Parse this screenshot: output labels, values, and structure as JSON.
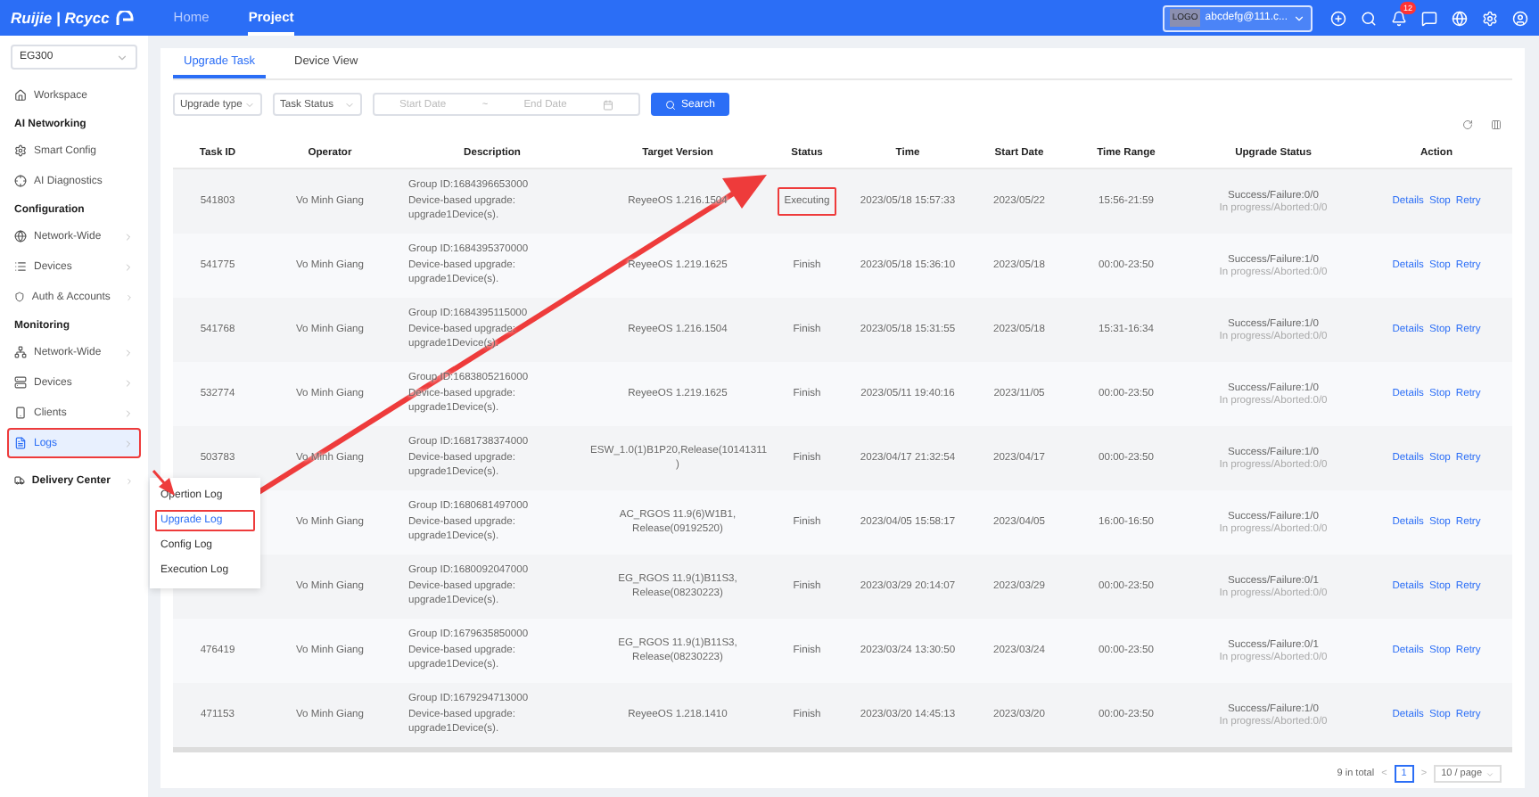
{
  "topbar": {
    "brand": "Ruijie | Rcycc",
    "nav": [
      {
        "label": "Home",
        "selected": false
      },
      {
        "label": "Project",
        "selected": true
      }
    ],
    "account": {
      "logo": "LOGO",
      "label": "abcdefg@111.c..."
    },
    "notifications": "12"
  },
  "sidebar": {
    "project": "EG300",
    "items": [
      {
        "kind": "item",
        "label": "Workspace",
        "expandable": false,
        "selected": false,
        "annotated": false
      },
      {
        "kind": "section",
        "label": "AI Networking"
      },
      {
        "kind": "item",
        "label": "Smart Config",
        "expandable": false,
        "selected": false,
        "annotated": false
      },
      {
        "kind": "item",
        "label": "AI Diagnostics",
        "expandable": false,
        "selected": false,
        "annotated": false
      },
      {
        "kind": "section",
        "label": "Configuration"
      },
      {
        "kind": "item",
        "label": "Network-Wide",
        "expandable": true,
        "selected": false,
        "annotated": false
      },
      {
        "kind": "item",
        "label": "Devices",
        "expandable": true,
        "selected": false,
        "annotated": false
      },
      {
        "kind": "item",
        "label": "Auth & Accounts",
        "expandable": true,
        "selected": false,
        "annotated": false
      },
      {
        "kind": "section",
        "label": "Monitoring"
      },
      {
        "kind": "item",
        "label": "Network-Wide",
        "expandable": true,
        "selected": false,
        "annotated": false
      },
      {
        "kind": "item",
        "label": "Devices",
        "expandable": true,
        "selected": false,
        "annotated": false
      },
      {
        "kind": "item",
        "label": "Clients",
        "expandable": true,
        "selected": false,
        "annotated": false
      },
      {
        "kind": "item",
        "label": "Logs",
        "expandable": true,
        "selected": true,
        "annotated": true
      },
      {
        "kind": "heading",
        "label": "Delivery Center",
        "expandable": true,
        "selected": false,
        "annotated": false
      }
    ]
  },
  "submenu": [
    {
      "label": "Opertion Log",
      "selected": false,
      "annotated": false
    },
    {
      "label": "Upgrade Log",
      "selected": true,
      "annotated": true
    },
    {
      "label": "Config Log",
      "selected": false,
      "annotated": false
    },
    {
      "label": "Execution Log",
      "selected": false,
      "annotated": false
    }
  ],
  "tabs": [
    {
      "label": "Upgrade Task",
      "selected": true
    },
    {
      "label": "Device View",
      "selected": false
    }
  ],
  "filters": {
    "upgrade_type": "Upgrade type",
    "task_status": "Task Status",
    "start_placeholder": "Start Date",
    "separator": "~",
    "end_placeholder": "End Date",
    "search": "Search"
  },
  "table": {
    "columns": [
      "Task ID",
      "Operator",
      "Description",
      "Target Version",
      "Status",
      "Time",
      "Start Date",
      "Time Range",
      "Upgrade Status",
      "Action"
    ],
    "rows": [
      {
        "task_id": "541803",
        "operator": "Vo Minh Giang",
        "description": [
          "Group ID:1684396653000",
          "Device-based upgrade:",
          "upgrade1Device(s)."
        ],
        "target_version": "ReyeeOS 1.216.1504",
        "status": "Executing",
        "annotated": true,
        "time": "2023/05/18 15:57:33",
        "start_date": "2023/05/22",
        "time_range": "15:56-21:59",
        "result": "Success/Failure:0/0",
        "progress": "In progress/Aborted:0/0",
        "actions": [
          "Details",
          "Stop",
          "Retry"
        ]
      },
      {
        "task_id": "541775",
        "operator": "Vo Minh Giang",
        "description": [
          "Group ID:1684395370000",
          "Device-based upgrade:",
          "upgrade1Device(s)."
        ],
        "target_version": "ReyeeOS 1.219.1625",
        "status": "Finish",
        "annotated": false,
        "time": "2023/05/18 15:36:10",
        "start_date": "2023/05/18",
        "time_range": "00:00-23:50",
        "result": "Success/Failure:1/0",
        "progress": "In progress/Aborted:0/0",
        "actions": [
          "Details",
          "Stop",
          "Retry"
        ]
      },
      {
        "task_id": "541768",
        "operator": "Vo Minh Giang",
        "description": [
          "Group ID:1684395115000",
          "Device-based upgrade:",
          "upgrade1Device(s)."
        ],
        "target_version": "ReyeeOS 1.216.1504",
        "status": "Finish",
        "annotated": false,
        "time": "2023/05/18 15:31:55",
        "start_date": "2023/05/18",
        "time_range": "15:31-16:34",
        "result": "Success/Failure:1/0",
        "progress": "In progress/Aborted:0/0",
        "actions": [
          "Details",
          "Stop",
          "Retry"
        ]
      },
      {
        "task_id": "532774",
        "operator": "Vo Minh Giang",
        "description": [
          "Group ID:1683805216000",
          "Device-based upgrade:",
          "upgrade1Device(s)."
        ],
        "target_version": "ReyeeOS 1.219.1625",
        "status": "Finish",
        "annotated": false,
        "time": "2023/05/11 19:40:16",
        "start_date": "2023/11/05",
        "time_range": "00:00-23:50",
        "result": "Success/Failure:1/0",
        "progress": "In progress/Aborted:0/0",
        "actions": [
          "Details",
          "Stop",
          "Retry"
        ]
      },
      {
        "task_id": "503783",
        "operator": "Vo Minh Giang",
        "description": [
          "Group ID:1681738374000",
          "Device-based upgrade:",
          "upgrade1Device(s)."
        ],
        "target_version": "ESW_1.0(1)B1P20,Release(10141311 )",
        "status": "Finish",
        "annotated": false,
        "time": "2023/04/17 21:32:54",
        "start_date": "2023/04/17",
        "time_range": "00:00-23:50",
        "result": "Success/Failure:1/0",
        "progress": "In progress/Aborted:0/0",
        "actions": [
          "Details",
          "Stop",
          "Retry"
        ]
      },
      {
        "operator": "Vo Minh Giang",
        "description": [
          "Group ID:1680681497000",
          "Device-based upgrade:",
          "upgrade1Device(s)."
        ],
        "target_version": "AC_RGOS 11.9(6)W1B1, Release(09192520)",
        "status": "Finish",
        "annotated": false,
        "time": "2023/04/05 15:58:17",
        "start_date": "2023/04/05",
        "time_range": "16:00-16:50",
        "result": "Success/Failure:1/0",
        "progress": "In progress/Aborted:0/0",
        "actions": [
          "Details",
          "Stop",
          "Retry"
        ]
      },
      {
        "operator": "Vo Minh Giang",
        "description": [
          "Group ID:1680092047000",
          "Device-based upgrade:",
          "upgrade1Device(s)."
        ],
        "target_version": "EG_RGOS 11.9(1)B11S3, Release(08230223)",
        "status": "Finish",
        "annotated": false,
        "time": "2023/03/29 20:14:07",
        "start_date": "2023/03/29",
        "time_range": "00:00-23:50",
        "result": "Success/Failure:0/1",
        "progress": "In progress/Aborted:0/0",
        "actions": [
          "Details",
          "Stop",
          "Retry"
        ]
      },
      {
        "task_id": "476419",
        "operator": "Vo Minh Giang",
        "description": [
          "Group ID:1679635850000",
          "Device-based upgrade:",
          "upgrade1Device(s)."
        ],
        "target_version": "EG_RGOS 11.9(1)B11S3, Release(08230223)",
        "status": "Finish",
        "annotated": false,
        "time": "2023/03/24 13:30:50",
        "start_date": "2023/03/24",
        "time_range": "00:00-23:50",
        "result": "Success/Failure:0/1",
        "progress": "In progress/Aborted:0/0",
        "actions": [
          "Details",
          "Stop",
          "Retry"
        ]
      },
      {
        "task_id": "471153",
        "operator": "Vo Minh Giang",
        "description": [
          "Group ID:1679294713000",
          "Device-based upgrade:",
          "upgrade1Device(s)."
        ],
        "target_version": "ReyeeOS 1.218.1410",
        "status": "Finish",
        "annotated": false,
        "time": "2023/03/20 14:45:13",
        "start_date": "2023/03/20",
        "time_range": "00:00-23:50",
        "result": "Success/Failure:1/0",
        "progress": "In progress/Aborted:0/0",
        "actions": [
          "Details",
          "Stop",
          "Retry"
        ]
      }
    ]
  },
  "pagination": {
    "total": "9 in total",
    "prev": "<",
    "pages": [
      {
        "label": "1",
        "selected": true
      }
    ],
    "next": ">",
    "page_size": "10 / page"
  }
}
